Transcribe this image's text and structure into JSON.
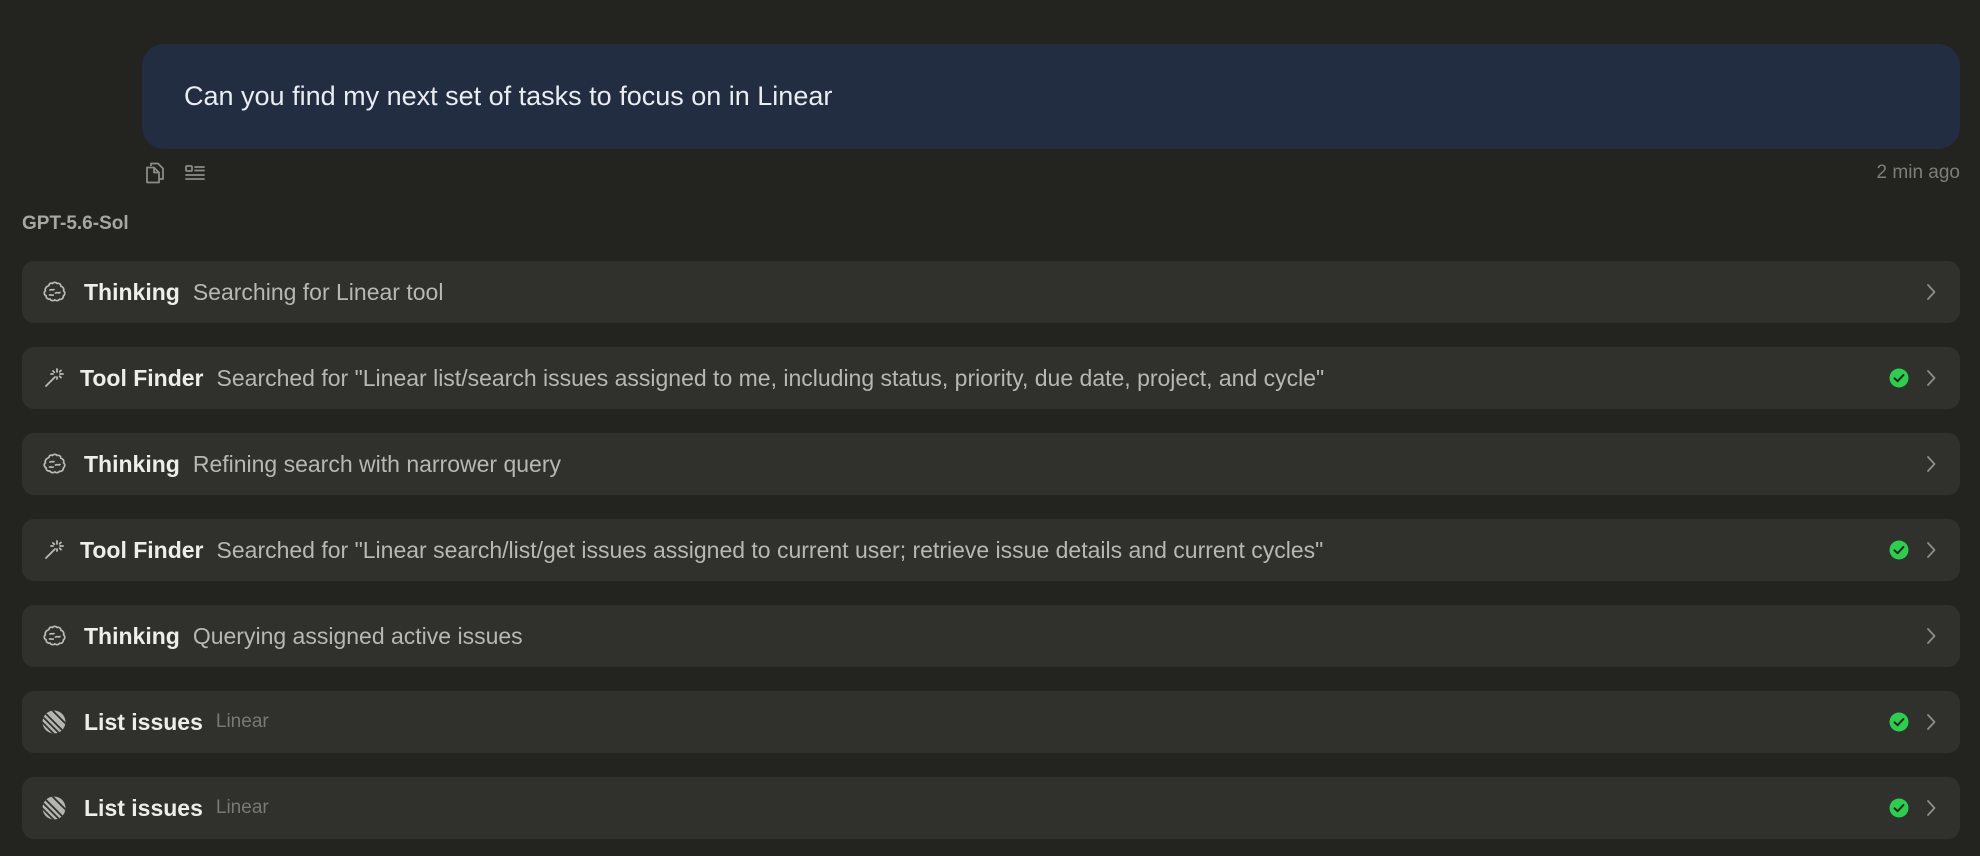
{
  "user_message": {
    "text": "Can you find my next set of tasks to focus on in Linear",
    "timestamp": "2 min ago",
    "actions": [
      {
        "icon": "copy-icon"
      },
      {
        "icon": "edit-text-icon"
      }
    ]
  },
  "model": {
    "name": "GPT-5.6-Sol"
  },
  "steps": [
    {
      "title": "Thinking",
      "detail": "Searching for Linear tool",
      "icon": "brain-icon",
      "completed": false
    },
    {
      "title": "Tool Finder",
      "detail": "Searched for \"Linear list/search issues assigned to me, including status, priority, due date, project, and cycle\"",
      "icon": "magic-wand-icon",
      "completed": true
    },
    {
      "title": "Thinking",
      "detail": "Refining search with narrower query",
      "icon": "brain-icon",
      "completed": false
    },
    {
      "title": "Tool Finder",
      "detail": "Searched for \"Linear search/list/get issues assigned to current user; retrieve issue details and current cycles\"",
      "icon": "magic-wand-icon",
      "completed": true
    },
    {
      "title": "Thinking",
      "detail": "Querying assigned active issues",
      "icon": "brain-icon",
      "completed": false
    },
    {
      "title": "List issues",
      "detail": "Linear",
      "icon": "linear-logo-icon",
      "completed": true
    },
    {
      "title": "List issues",
      "detail": "Linear",
      "icon": "linear-logo-icon",
      "completed": true
    }
  ],
  "colors": {
    "background": "#232320",
    "user_bubble": "#222d42",
    "step_background": "#30302d",
    "success": "#2ecc4f"
  }
}
